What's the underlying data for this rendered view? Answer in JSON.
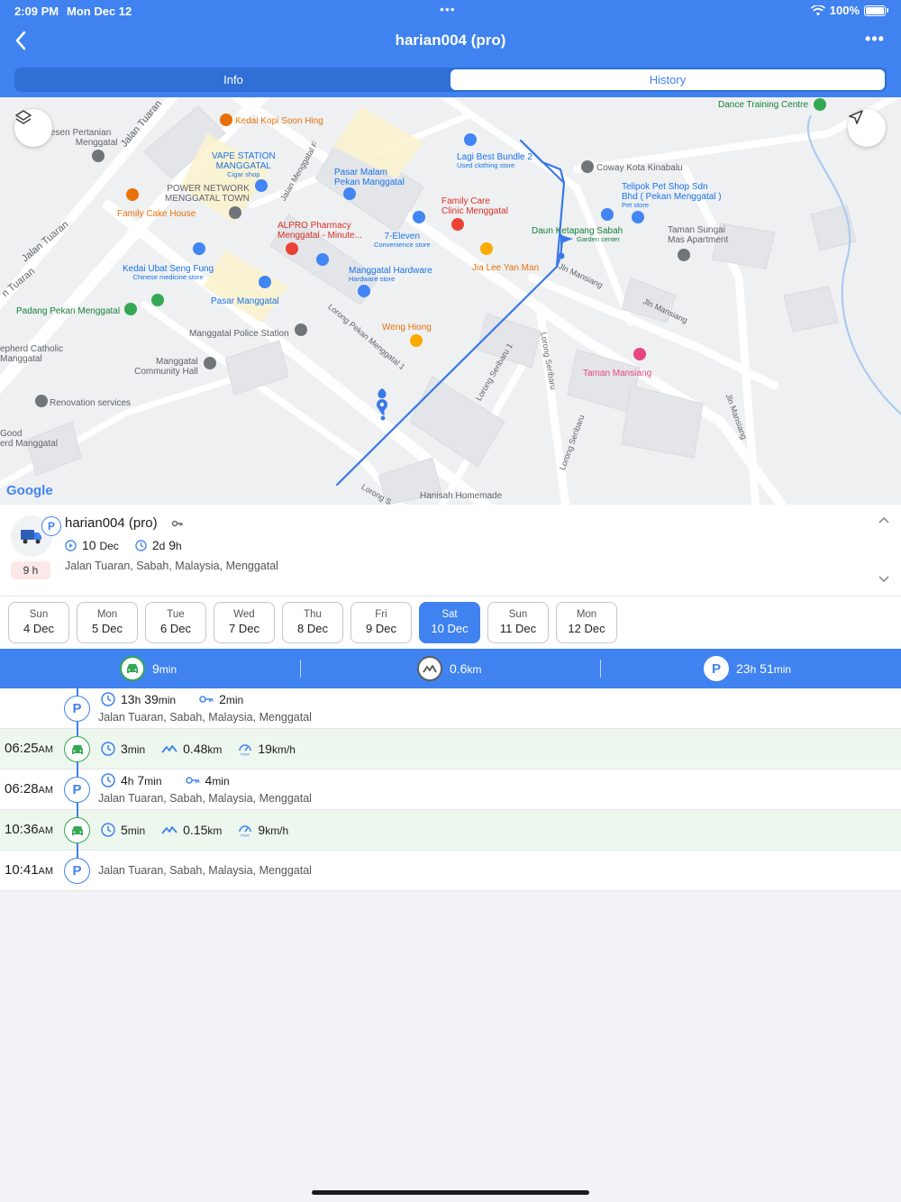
{
  "status_bar": {
    "time": "2:09 PM",
    "date": "Mon Dec 12",
    "battery": "100%"
  },
  "nav": {
    "title": "harian004 (pro)"
  },
  "tabs": [
    {
      "label": "Info",
      "active": false
    },
    {
      "label": "History",
      "active": true
    }
  ],
  "map": {
    "labels": {
      "dance": "Dance Training Centre",
      "kedai_kopi": "Kedai Kopi Soon Hing",
      "pertanian1": "esen Pertanian",
      "pertanian2": "Menggatal",
      "jalan_tuaran1": "Jalan Tuaran",
      "vape1": "VAPE STATION",
      "vape2": "MANGGATAL",
      "vape_sub": "Cigar shop",
      "jalan_menggatal_f": "Jalan Menggatal F",
      "pasar_malam1": "Pasar Malam",
      "pasar_malam2": "Pekan Manggatal",
      "lagi_best": "Lagi Best Bundle 2",
      "lagi_best_sub": "Used clothing store",
      "coway": "Coway Kota Kinabalu",
      "power1": "POWER NETWORK",
      "power2": "MENGGATAL TOWN",
      "family_cake": "Family Cake House",
      "family_care1": "Family Care",
      "family_care2": "Clinic Menggatal",
      "telipok1": "Telipok Pet Shop Sdn",
      "telipok2": "Bhd ( Pekan Menggatal )",
      "telipok_sub": "Pet store",
      "alpro1": "ALPRO Pharmacy",
      "alpro2": "Menggatal - Minute...",
      "seven1": "7-Eleven",
      "seven_sub": "Convenience store",
      "daun1": "Daun Ketapang Sabah",
      "daun_sub": "Garden center",
      "taman_sungai1": "Taman Sungai",
      "taman_sungai2": "Mas Apartment",
      "jalan_tuaran2": "Jalan Tuaran",
      "jalan_tuaran3": "n Tuaran",
      "kedai_ubat": "Kedai Ubat Seng Fung",
      "kedai_ubat_sub": "Chinese medicine store",
      "manggatal_hw": "Manggatal Hardware",
      "manggatal_hw_sub": "Hardware store",
      "jia_lee": "Jia Lee Yan Man",
      "jln_mansiang1": "Jln Mansiang",
      "pasar_manggatal": "Pasar Manggatal",
      "jln_mansiang2": "Jln Mansiang",
      "padang": "Padang Pekan Menggatal",
      "weng_hiong": "Weng Hiong",
      "police": "Manggatal Police Station",
      "lorong_pekan": "Lorong Pekan Menggatal 1",
      "shepherd1": "epherd Catholic",
      "shepherd2": "Manggatal",
      "community1": "Manggatal",
      "community2": "Community Hall",
      "lorong_seribaru1": "Lorong Seribaru 1",
      "lorong_seribaru": "Lorong Seribaru",
      "taman_mansiang": "Taman Mansiang",
      "jln_mansiang3": "Jln Mansiang",
      "renovation": "Renovation services",
      "good1": "Good",
      "good2": "erd Manggatal",
      "lorong_seribaru2": "Lorong Seribaru",
      "lorong_s": "Lorong S",
      "hanisah": "Hanisah Homemade",
      "google": "Google"
    }
  },
  "vehicle": {
    "name": "harian004 (pro)",
    "badge": "P",
    "hours_badge": "9 h",
    "date_num": "10",
    "date_mon": "Dec",
    "duration_d": "2",
    "duration_d_unit": "d",
    "duration_h": "9",
    "duration_h_unit": "h",
    "address": "Jalan Tuaran, Sabah, Malaysia, Menggatal"
  },
  "days": [
    {
      "dow": "Sun",
      "dm": "4 Dec",
      "active": false
    },
    {
      "dow": "Mon",
      "dm": "5 Dec",
      "active": false
    },
    {
      "dow": "Tue",
      "dm": "6 Dec",
      "active": false
    },
    {
      "dow": "Wed",
      "dm": "7 Dec",
      "active": false
    },
    {
      "dow": "Thu",
      "dm": "8 Dec",
      "active": false
    },
    {
      "dow": "Fri",
      "dm": "9 Dec",
      "active": false
    },
    {
      "dow": "Sat",
      "dm": "10 Dec",
      "active": true
    },
    {
      "dow": "Sun",
      "dm": "11 Dec",
      "active": false
    },
    {
      "dow": "Mon",
      "dm": "12 Dec",
      "active": false
    }
  ],
  "summary": {
    "drive_value": "9",
    "drive_unit": "min",
    "distance_value": "0.6",
    "distance_unit": "km",
    "park_value_h": "23",
    "park_unit_h": "h",
    "park_value_m": "51",
    "park_unit_m": "min"
  },
  "timeline": [
    {
      "type": "park",
      "time": "",
      "ampm": "",
      "dur_h": "13",
      "dur_h_unit": "h",
      "dur_m": "39",
      "dur_m_unit": "min",
      "key_val": "2",
      "key_unit": "min",
      "address": "Jalan Tuaran, Sabah, Malaysia, Menggatal"
    },
    {
      "type": "drive",
      "time": "06:25",
      "ampm": "AM",
      "dur": "3",
      "dur_unit": "min",
      "dist": "0.48",
      "dist_unit": "km",
      "speed": "19",
      "speed_unit": "km/h"
    },
    {
      "type": "park",
      "time": "06:28",
      "ampm": "AM",
      "dur_h": "4",
      "dur_h_unit": "h",
      "dur_m": "7",
      "dur_m_unit": "min",
      "key_val": "4",
      "key_unit": "min",
      "address": "Jalan Tuaran, Sabah, Malaysia, Menggatal"
    },
    {
      "type": "drive",
      "time": "10:36",
      "ampm": "AM",
      "dur": "5",
      "dur_unit": "min",
      "dist": "0.15",
      "dist_unit": "km",
      "speed": "9",
      "speed_unit": "km/h"
    },
    {
      "type": "park_end",
      "time": "10:41",
      "ampm": "AM",
      "address": "Jalan Tuaran, Sabah, Malaysia, Menggatal"
    }
  ],
  "colors": {
    "brand": "#3f82f0",
    "drive_green": "#34a853",
    "route": "#3b78e7"
  }
}
